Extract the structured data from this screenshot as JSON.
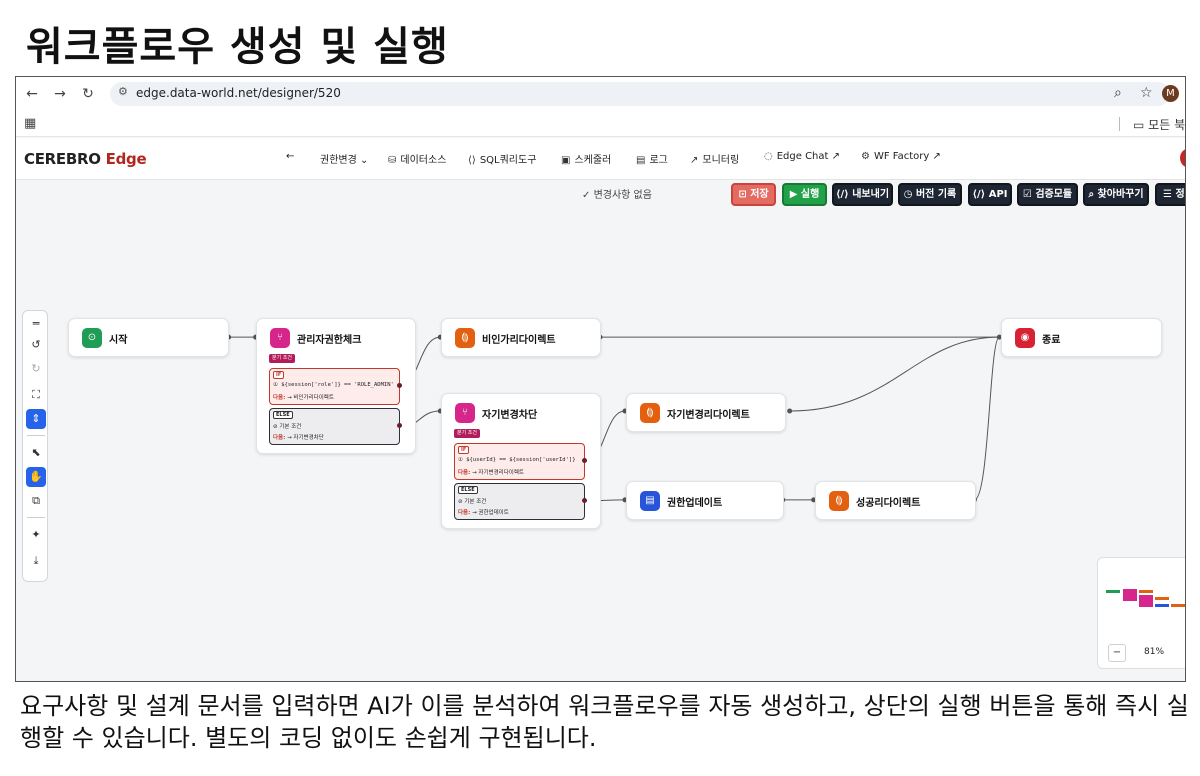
{
  "slide": {
    "title": "워크플로우 생성 및 실행",
    "caption": "요구사항 및 설계 문서를 입력하면 AI가 이를 분석하여 워크플로우를 자동 생성하고, 상단의 실행 버튼을 통해 즉시 실행할 수 있습니다. 별도의 코딩 없이도 손쉽게 구현됩니다."
  },
  "browser": {
    "url": "edge.data-world.net/designer/520",
    "avatar_letter": "M",
    "bookmark_folder": "모든 북"
  },
  "app": {
    "brand_main": "CEREBRO",
    "brand_accent": "Edge",
    "nav": [
      {
        "label": "권한변경",
        "icon": "chevron-down"
      },
      {
        "label": "데이터소스",
        "icon": "database"
      },
      {
        "label": "SQL쿼리도구",
        "icon": "code"
      },
      {
        "label": "스케줄러",
        "icon": "calendar"
      },
      {
        "label": "로그",
        "icon": "document"
      },
      {
        "label": "모니터링",
        "icon": "chart-line"
      },
      {
        "label": "Edge Chat",
        "icon": "chat"
      },
      {
        "label": "WF Factory",
        "icon": "gear"
      }
    ]
  },
  "toolbar": {
    "status": "변경사항 없음",
    "save": "저장",
    "run": "실행",
    "export": "내보내기",
    "history": "버전 기록",
    "api": "API",
    "validate": "검증모듈",
    "find": "찾아바꾸기",
    "more": "정"
  },
  "nodes": {
    "start": "시작",
    "admin_check": "관리자권한체크",
    "non_admin_redirect": "비인가리다이렉트",
    "self_change_block": "자기변경차단",
    "self_change_redirect": "자기변경리다이렉트",
    "permission_update": "권한업데이트",
    "success_redirect": "성공리다이렉트",
    "end": "종료"
  },
  "branches": {
    "tag": "분기 조건",
    "if_kw": "IF",
    "else_kw": "ELSE",
    "next_label": "다음:",
    "default_cond": "기본 조건",
    "admin_if_cond": "① ${session['role']} == 'ROLE_ADMIN'",
    "admin_if_next": "→ 비인가리다이렉트",
    "admin_else_next": "→ 자기변경차단",
    "self_if_cond": "① ${userId} == ${session['userId']}",
    "self_if_next": "→ 자기변경리다이렉트",
    "self_else_next": "→ 권한업데이트"
  },
  "minimap": {
    "zoom": "81%",
    "colors": [
      "#1f9d55",
      "#d6268b",
      "#e2600f",
      "#2855d8",
      "#d62232"
    ]
  }
}
